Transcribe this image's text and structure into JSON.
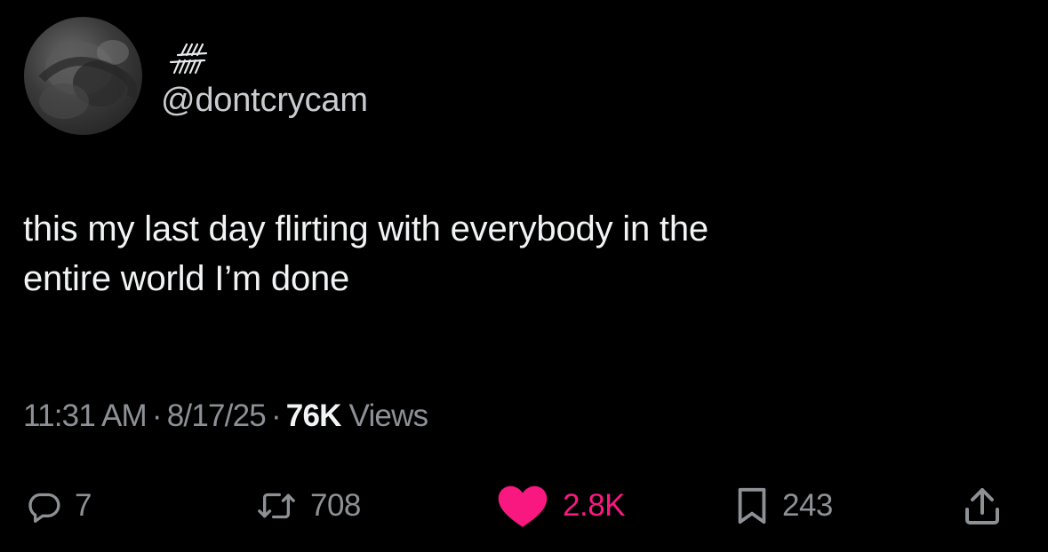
{
  "user": {
    "display_name_glyph": "stylized-scribble-name",
    "handle": "@dontcrycam"
  },
  "tweet": {
    "text_lines": [
      "this my last day flirting with everybody in the",
      "entire world I’m done"
    ]
  },
  "meta": {
    "time": "11:31 AM",
    "separator": "·",
    "date": "8/17/25",
    "views_count": "76K",
    "views_label": "Views"
  },
  "actions": {
    "replies": "7",
    "reposts": "708",
    "likes": "2.8K",
    "bookmarks": "243"
  },
  "icons": {
    "reply": "reply-bubble-icon",
    "repost": "repost-arrows-icon",
    "like": "heart-icon",
    "bookmark": "bookmark-icon",
    "share": "share-upload-icon"
  },
  "colors": {
    "background": "#000000",
    "text": "#f2f3f4",
    "muted": "#8d9196",
    "like": "#f91880"
  }
}
